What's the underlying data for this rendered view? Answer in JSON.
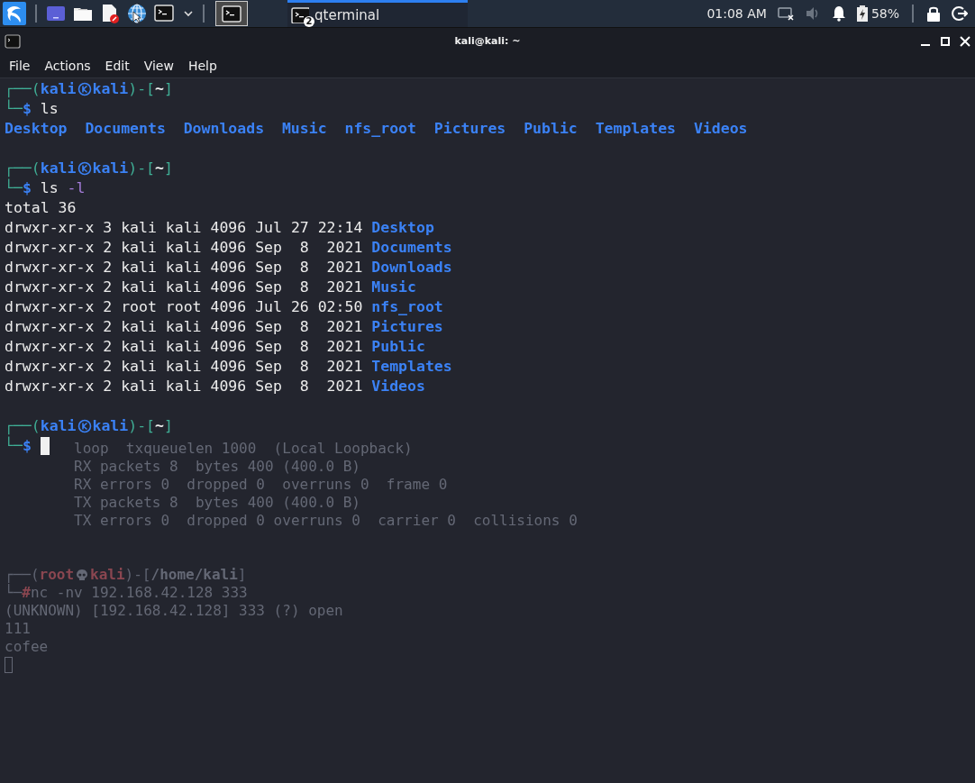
{
  "taskbar": {
    "tasks": [
      {
        "label": "qterminal",
        "badge": "2",
        "selected": true
      }
    ],
    "clock": "01:08 AM",
    "battery": "58%"
  },
  "window": {
    "title": "kali@kali: ~"
  },
  "menu": [
    "File",
    "Actions",
    "Edit",
    "View",
    "Help"
  ],
  "terminal": {
    "lines": [
      {
        "kind": "text",
        "segments": [
          {
            "kind": "frame",
            "text": "┌──("
          },
          {
            "kind": "userhost",
            "user": "kali",
            "host": "kali"
          },
          {
            "kind": "frame",
            "text": ")-["
          },
          {
            "kind": "path",
            "text": "~"
          },
          {
            "kind": "frame",
            "text": "]"
          }
        ]
      },
      {
        "kind": "text",
        "segments": [
          {
            "kind": "frame",
            "text": "└─"
          },
          {
            "kind": "symbol",
            "text": "$"
          },
          {
            "kind": "command",
            "text": "ls"
          }
        ]
      },
      {
        "kind": "listing",
        "items": [
          "Desktop",
          "Documents",
          "Downloads",
          "Music",
          "nfs_root",
          "Pictures",
          "Public",
          "Templates",
          "Videos"
        ]
      },
      {
        "kind": "blank"
      },
      {
        "kind": "text",
        "segments": [
          {
            "kind": "frame",
            "text": "┌──("
          },
          {
            "kind": "userhost",
            "user": "kali",
            "host": "kali"
          },
          {
            "kind": "frame",
            "text": ")-["
          },
          {
            "kind": "path",
            "text": "~"
          },
          {
            "kind": "frame",
            "text": "]"
          }
        ]
      },
      {
        "kind": "text",
        "segments": [
          {
            "kind": "frame",
            "text": "└─"
          },
          {
            "kind": "symbol",
            "text": "$"
          },
          {
            "kind": "command",
            "text": "ls"
          },
          {
            "kind": "option",
            "text": "-l"
          }
        ]
      },
      {
        "kind": "text",
        "segments": [
          {
            "kind": "plain",
            "text": "total 36"
          }
        ]
      },
      {
        "kind": "text",
        "segments": [
          {
            "kind": "plain",
            "text": "drwxr-xr-x 3 kali kali 4096 Jul 27 22:14 "
          },
          {
            "kind": "dir",
            "text": "Desktop"
          }
        ]
      },
      {
        "kind": "text",
        "segments": [
          {
            "kind": "plain",
            "text": "drwxr-xr-x 2 kali kali 4096 Sep  8  2021 "
          },
          {
            "kind": "dir",
            "text": "Documents"
          }
        ]
      },
      {
        "kind": "text",
        "segments": [
          {
            "kind": "plain",
            "text": "drwxr-xr-x 2 kali kali 4096 Sep  8  2021 "
          },
          {
            "kind": "dir",
            "text": "Downloads"
          }
        ]
      },
      {
        "kind": "text",
        "segments": [
          {
            "kind": "plain",
            "text": "drwxr-xr-x 2 kali kali 4096 Sep  8  2021 "
          },
          {
            "kind": "dir",
            "text": "Music"
          }
        ]
      },
      {
        "kind": "text",
        "segments": [
          {
            "kind": "plain",
            "text": "drwxr-xr-x 2 root root 4096 Jul 26 02:50 "
          },
          {
            "kind": "dir",
            "text": "nfs_root"
          }
        ]
      },
      {
        "kind": "text",
        "segments": [
          {
            "kind": "plain",
            "text": "drwxr-xr-x 2 kali kali 4096 Sep  8  2021 "
          },
          {
            "kind": "dir",
            "text": "Pictures"
          }
        ]
      },
      {
        "kind": "text",
        "segments": [
          {
            "kind": "plain",
            "text": "drwxr-xr-x 2 kali kali 4096 Sep  8  2021 "
          },
          {
            "kind": "dir",
            "text": "Public"
          }
        ]
      },
      {
        "kind": "text",
        "segments": [
          {
            "kind": "plain",
            "text": "drwxr-xr-x 2 kali kali 4096 Sep  8  2021 "
          },
          {
            "kind": "dir",
            "text": "Templates"
          }
        ]
      },
      {
        "kind": "text",
        "segments": [
          {
            "kind": "plain",
            "text": "drwxr-xr-x 2 kali kali 4096 Sep  8  2021 "
          },
          {
            "kind": "dir",
            "text": "Videos"
          }
        ]
      },
      {
        "kind": "blank"
      },
      {
        "kind": "text",
        "segments": [
          {
            "kind": "frame",
            "text": "┌──("
          },
          {
            "kind": "userhost",
            "user": "kali",
            "host": "kali"
          },
          {
            "kind": "frame",
            "text": ")-["
          },
          {
            "kind": "path",
            "text": "~"
          },
          {
            "kind": "frame",
            "text": "]"
          }
        ]
      },
      {
        "kind": "text",
        "segments": [
          {
            "kind": "frame",
            "text": "└─"
          },
          {
            "kind": "symbol",
            "text": "$"
          },
          {
            "kind": "cursor"
          }
        ]
      }
    ]
  },
  "background_window": {
    "lines": [
      {
        "kind": "indented",
        "text": "loop  txqueuelen 1000  (Local Loopback)"
      },
      {
        "kind": "indented",
        "text": "RX packets 8  bytes 400 (400.0 B)"
      },
      {
        "kind": "indented",
        "text": "RX errors 0  dropped 0  overruns 0  frame 0"
      },
      {
        "kind": "indented",
        "text": "TX packets 8  bytes 400 (400.0 B)"
      },
      {
        "kind": "indented",
        "text": "TX errors 0  dropped 0 overruns 0  carrier 0  collisions 0"
      },
      {
        "kind": "blank"
      },
      {
        "kind": "blank"
      },
      {
        "kind": "prompt",
        "frame_start": "┌──(",
        "user": "root",
        "host": "kali",
        "frame_mid": ")-[",
        "path": "/home/kali",
        "frame_end": "]"
      },
      {
        "kind": "command",
        "frame": "└─",
        "symbol": "#",
        "command": "nc",
        "option": "-nv",
        "args": "192.168.42.128 333"
      },
      {
        "kind": "plain",
        "text": "(UNKNOWN) [192.168.42.128] 333 (?) open"
      },
      {
        "kind": "plain",
        "text": "111"
      },
      {
        "kind": "plain",
        "text": "cofee"
      },
      {
        "kind": "cursor"
      }
    ]
  }
}
